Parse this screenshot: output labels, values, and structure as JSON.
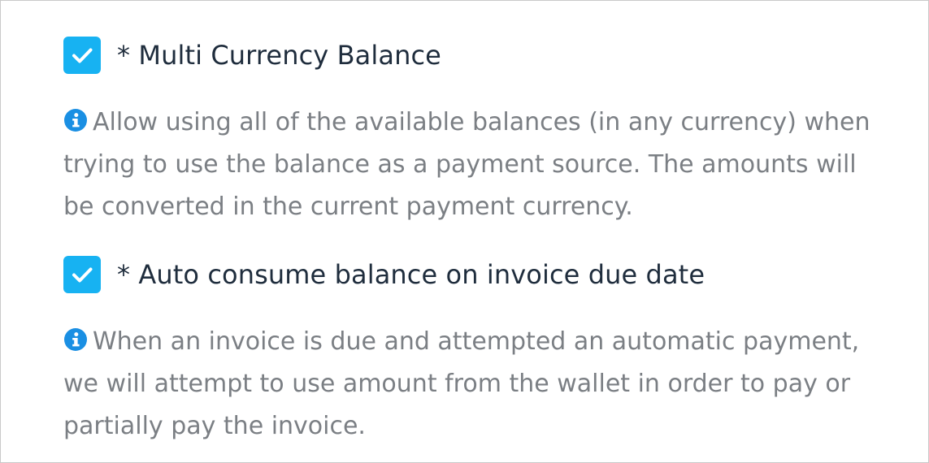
{
  "settings": [
    {
      "label": "* Multi Currency Balance",
      "checked": true,
      "help_icon": "info-icon",
      "help_text": "Allow using all of the available balances (in any currency) when trying to use the balance as a payment source. The amounts will be converted in the current payment currency."
    },
    {
      "label": "* Auto consume balance on invoice due date",
      "checked": true,
      "help_icon": "info-icon",
      "help_text": "When an invoice is due and attempted an automatic payment, we will attempt to use amount from the wallet in order to pay or partially pay the invoice."
    }
  ],
  "colors": {
    "checkbox": "#17b2f2",
    "info_icon": "#1a8fe3",
    "label_text": "#1f2d3d",
    "help_text": "#7b7f84"
  }
}
